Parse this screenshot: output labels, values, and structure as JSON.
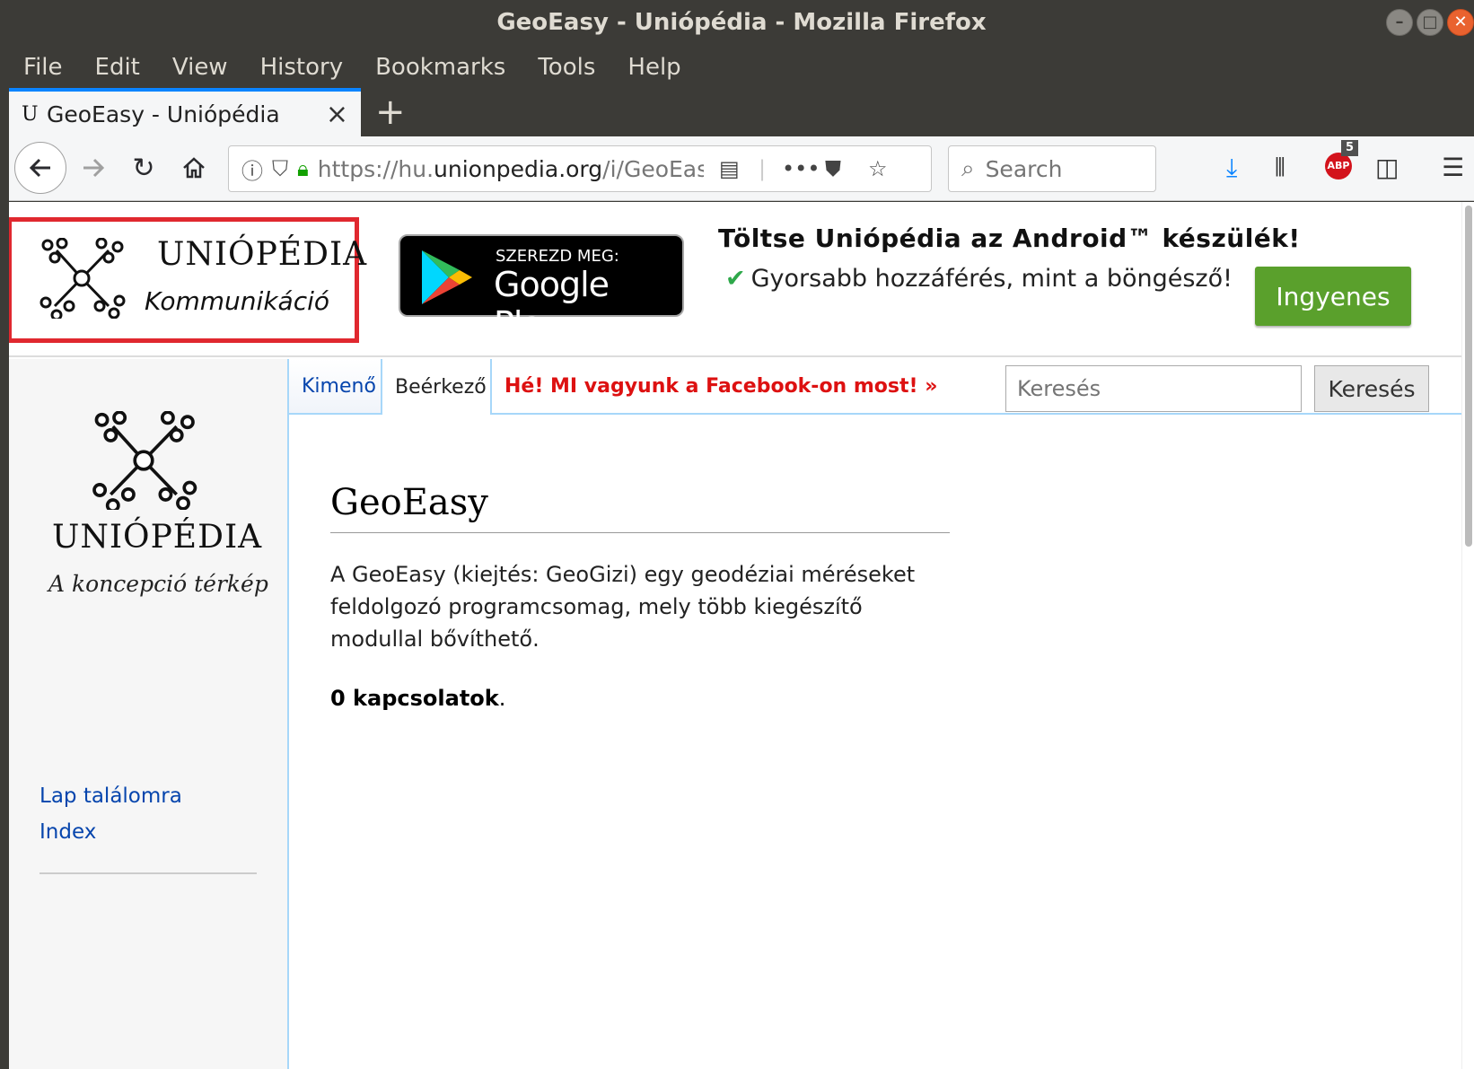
{
  "window": {
    "title": "GeoEasy - Uniópédia - Mozilla Firefox"
  },
  "menu": {
    "file": "File",
    "edit": "Edit",
    "view": "View",
    "history": "History",
    "bookmarks": "Bookmarks",
    "tools": "Tools",
    "help": "Help"
  },
  "tab": {
    "favicon": "U",
    "title": "GeoEasy - Uniópédia"
  },
  "nav": {
    "url_prefix": "https://hu.",
    "url_domain": "unionpedia.org",
    "url_rest": "/i/GeoEasy",
    "search_placeholder": "Search",
    "abp_label": "ABP",
    "abp_badge": "5"
  },
  "banner": {
    "brand": "UNIÓPÉDIA",
    "subtitle": "Kommunikáció",
    "gplay_small": "SZEREZD MEG:",
    "gplay_big": "Google Play",
    "promo_title": "Töltse Uniópédia az Android™ készülék!",
    "promo_sub": "Gyorsabb hozzáférés, mint a böngésző!",
    "free_button": "Ingyenes"
  },
  "sidebar": {
    "brand": "UNIÓPÉDIA",
    "tagline": "A koncepció térkép",
    "links": [
      {
        "label": "Lap találomra"
      },
      {
        "label": "Index"
      }
    ]
  },
  "page_tabs": {
    "outgoing": "Kimenő",
    "incoming": "Beérkező",
    "facebook": "Hé! MI vagyunk a Facebook-on most! »"
  },
  "site_search": {
    "placeholder": "Keresés",
    "button": "Keresés"
  },
  "article": {
    "title": "GeoEasy",
    "description": "A GeoEasy (kiejtés: GeoGizi) egy geodéziai méréseket feldolgozó programcsomag, mely több kiegészítő modullal bővíthető.",
    "links_count_bold": "0 kapcsolatok",
    "links_count_tail": "."
  },
  "colors": {
    "accent": "#0a84ff",
    "promo_green": "#5aa02c",
    "highlight_red": "#e0282f",
    "link": "#0645ad"
  }
}
